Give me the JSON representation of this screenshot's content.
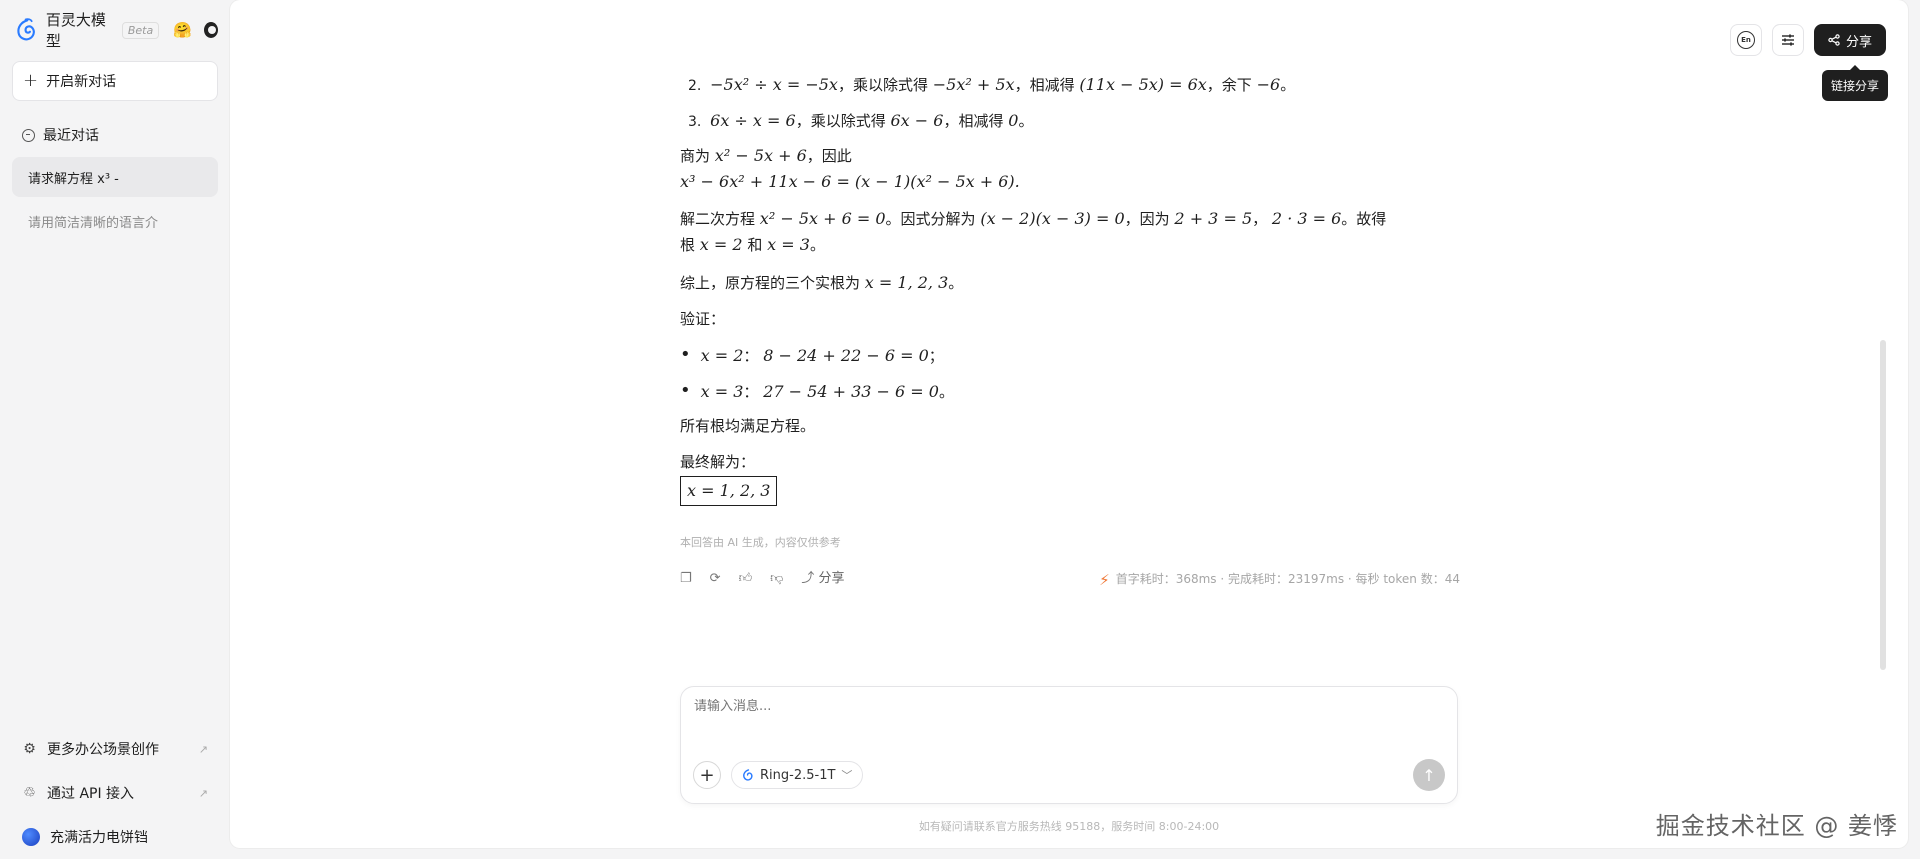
{
  "brand": {
    "name": "百灵大模型",
    "badge": "Beta"
  },
  "sidebar": {
    "new_chat": "开启新对话",
    "recent_label": "最近对话",
    "chats": [
      "请求解方程 x³ -",
      "请用简洁清晰的语言介"
    ],
    "bottom": [
      {
        "label": "更多办公场景创作",
        "icon": "sparkle-icon"
      },
      {
        "label": "通过 API 接入",
        "icon": "api-icon"
      },
      {
        "label": "充满活力电饼铛",
        "icon": "avatar"
      }
    ]
  },
  "header": {
    "share": "分享",
    "tooltip": "链接分享",
    "lang": "En"
  },
  "content": {
    "step2_a": "2.",
    "step2": [
      "−5x² ÷ x = −5x",
      "，乘以除式得",
      "−5x² + 5x",
      "，相减得",
      "(11x − 5x) = 6x",
      "，余下",
      "−6",
      "。"
    ],
    "step3": [
      "3.",
      "6x ÷ x = 6",
      "，乘以除式得",
      "6x − 6",
      "，相减得",
      "0",
      "。"
    ],
    "quot_prefix": "商为",
    "quot_math": "x² − 5x + 6",
    "quot_suffix": "，因此",
    "factor_eq": "x³ − 6x² + 11x − 6 = (x − 1)(x² − 5x + 6).",
    "quad": [
      "解二次方程",
      "x² − 5x + 6 = 0",
      "。因式分解为",
      "(x − 2)(x − 3) = 0",
      "，因为",
      "2 + 3 = 5",
      "，",
      "2 · 3 = 6",
      "。故得"
    ],
    "roots": [
      "根",
      "x = 2",
      "和",
      "x = 3",
      "。"
    ],
    "summary": [
      "综上，原方程的三个实根为",
      "x = 1, 2, 3",
      "。"
    ],
    "verify_label": "验证：",
    "verify": [
      {
        "x": "x = 2",
        "sep": "：",
        "calc": "8 − 24 + 22 − 6 = 0",
        "end": "；"
      },
      {
        "x": "x = 3",
        "sep": "：",
        "calc": "27 − 54 + 33 − 6 = 0",
        "end": "。"
      }
    ],
    "all_satisfy": "所有根均满足方程。",
    "final_label": "最终解为：",
    "final_answer": "x = 1,  2,  3",
    "disclaimer": "本回答由 AI 生成，内容仅供参考",
    "share_action": "分享",
    "stats": "首字耗时：368ms · 完成耗时：23197ms · 每秒 token 数：44"
  },
  "input": {
    "placeholder": "请输入消息...",
    "model": "Ring-2.5-1T"
  },
  "footer": "如有疑问请联系官方服务热线 95188，服务时间 8:00-24:00",
  "watermark": "掘金技术社区 @ 姜悸",
  "colors": {
    "accent": "#1f1f1f",
    "bolt": "#f07a3a",
    "logo": "#2a7bff"
  }
}
